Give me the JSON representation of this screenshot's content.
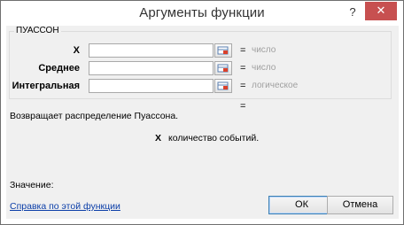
{
  "window": {
    "title": "Аргументы функции",
    "help_glyph": "?",
    "close_glyph": "✕"
  },
  "function": {
    "name": "ПУАССОН",
    "args": [
      {
        "label": "X",
        "value": "",
        "hint": "число"
      },
      {
        "label": "Среднее",
        "value": "",
        "hint": "число"
      },
      {
        "label": "Интегральная",
        "value": "",
        "hint": "логическое"
      }
    ],
    "equals": "=",
    "description": "Возвращает распределение Пуассона.",
    "arg_name": "X",
    "arg_description": "количество событий."
  },
  "result": {
    "label": "Значение:"
  },
  "footer": {
    "help_link": "Справка по этой функции",
    "ok_label": "ОК",
    "cancel_label": "Отмена"
  },
  "colors": {
    "close_button": "#c75050",
    "hint_text": "#a0a0a0",
    "link": "#0b3ea8"
  }
}
